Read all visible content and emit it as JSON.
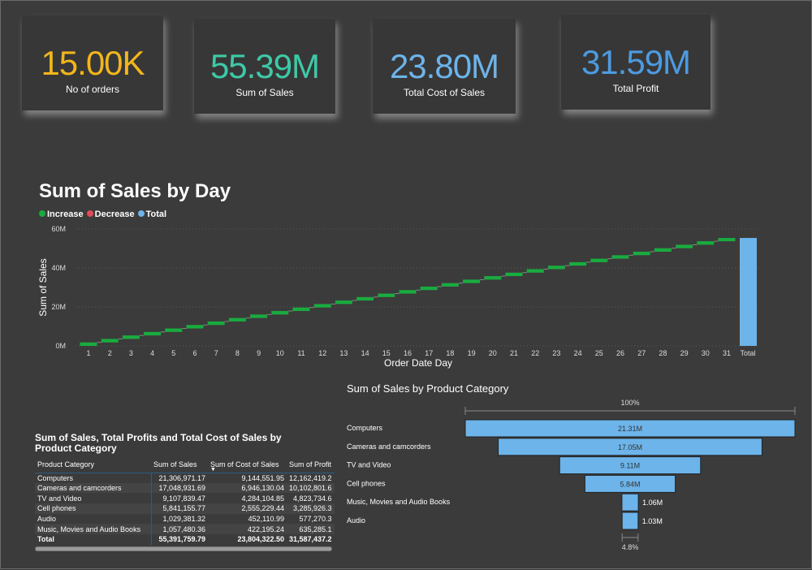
{
  "kpis": [
    {
      "value": "15.00K",
      "label": "No of orders",
      "color": "#f2b51c"
    },
    {
      "value": "55.39M",
      "label": "Sum of Sales",
      "color": "#3ec9a7"
    },
    {
      "value": "23.80M",
      "label": "Total Cost of Sales",
      "color": "#6cb4ea"
    },
    {
      "value": "31.59M",
      "label": "Total Profit",
      "color": "#4d9be0"
    }
  ],
  "chart_data": [
    {
      "type": "waterfall",
      "title": "Sum of Sales by Day",
      "xlabel": "Order Date Day",
      "ylabel": "Sum of Sales",
      "legend": [
        {
          "name": "Increase",
          "color": "#1aab40"
        },
        {
          "name": "Decrease",
          "color": "#e04b5a"
        },
        {
          "name": "Total",
          "color": "#6cb4ea"
        }
      ],
      "legend_position": "top-left",
      "ylim": [
        0,
        60
      ],
      "yticks": [
        "0M",
        "20M",
        "40M",
        "60M"
      ],
      "ytick_values": [
        0,
        20,
        40,
        60
      ],
      "grid": true,
      "categories": [
        "1",
        "2",
        "3",
        "4",
        "5",
        "6",
        "7",
        "8",
        "9",
        "10",
        "11",
        "12",
        "13",
        "14",
        "15",
        "16",
        "17",
        "18",
        "19",
        "20",
        "21",
        "22",
        "23",
        "24",
        "25",
        "26",
        "27",
        "28",
        "29",
        "30",
        "31",
        "Total"
      ],
      "values_millions": [
        1.79,
        1.79,
        1.79,
        1.79,
        1.79,
        1.79,
        1.79,
        1.79,
        1.79,
        1.79,
        1.79,
        1.79,
        1.79,
        1.79,
        1.79,
        1.79,
        1.79,
        1.79,
        1.79,
        1.79,
        1.79,
        1.79,
        1.79,
        1.79,
        1.79,
        1.79,
        1.79,
        1.79,
        1.79,
        1.79,
        1.69
      ],
      "total_millions": 55.39
    },
    {
      "type": "funnel",
      "title": "Sum of Sales by Product Category",
      "top_label": "100%",
      "bottom_label": "4.8%",
      "categories": [
        "Computers",
        "Cameras and camcorders",
        "TV and Video",
        "Cell phones",
        "Music, Movies and Audio Books",
        "Audio"
      ],
      "values_millions": [
        21.31,
        17.05,
        9.11,
        5.84,
        1.06,
        1.03
      ],
      "labels": [
        "21.31M",
        "17.05M",
        "9.11M",
        "5.84M",
        "1.06M",
        "1.03M"
      ],
      "color": "#6cb4ea"
    }
  ],
  "table": {
    "title": "Sum of Sales, Total Profits and Total Cost of Sales by Product Category",
    "columns": [
      "Product Category",
      "Sum of Sales",
      "Sum of Cost of Sales",
      "Sum of Profit"
    ],
    "sort_column": "Sum of Cost of Sales",
    "rows": [
      [
        "Computers",
        "21,306,971.17",
        "9,144,551.95",
        "12,162,419.2"
      ],
      [
        "Cameras and camcorders",
        "17,048,931.69",
        "6,946,130.04",
        "10,102,801.6"
      ],
      [
        "TV and Video",
        "9,107,839.47",
        "4,284,104.85",
        "4,823,734.6"
      ],
      [
        "Cell phones",
        "5,841,155.77",
        "2,555,229.44",
        "3,285,926.3"
      ],
      [
        "Audio",
        "1,029,381.32",
        "452,110.99",
        "577,270.3"
      ],
      [
        "Music, Movies and Audio Books",
        "1,057,480.36",
        "422,195.24",
        "635,285.1"
      ]
    ],
    "total": [
      "Total",
      "55,391,759.79",
      "23,804,322.50",
      "31,587,437.2"
    ]
  }
}
